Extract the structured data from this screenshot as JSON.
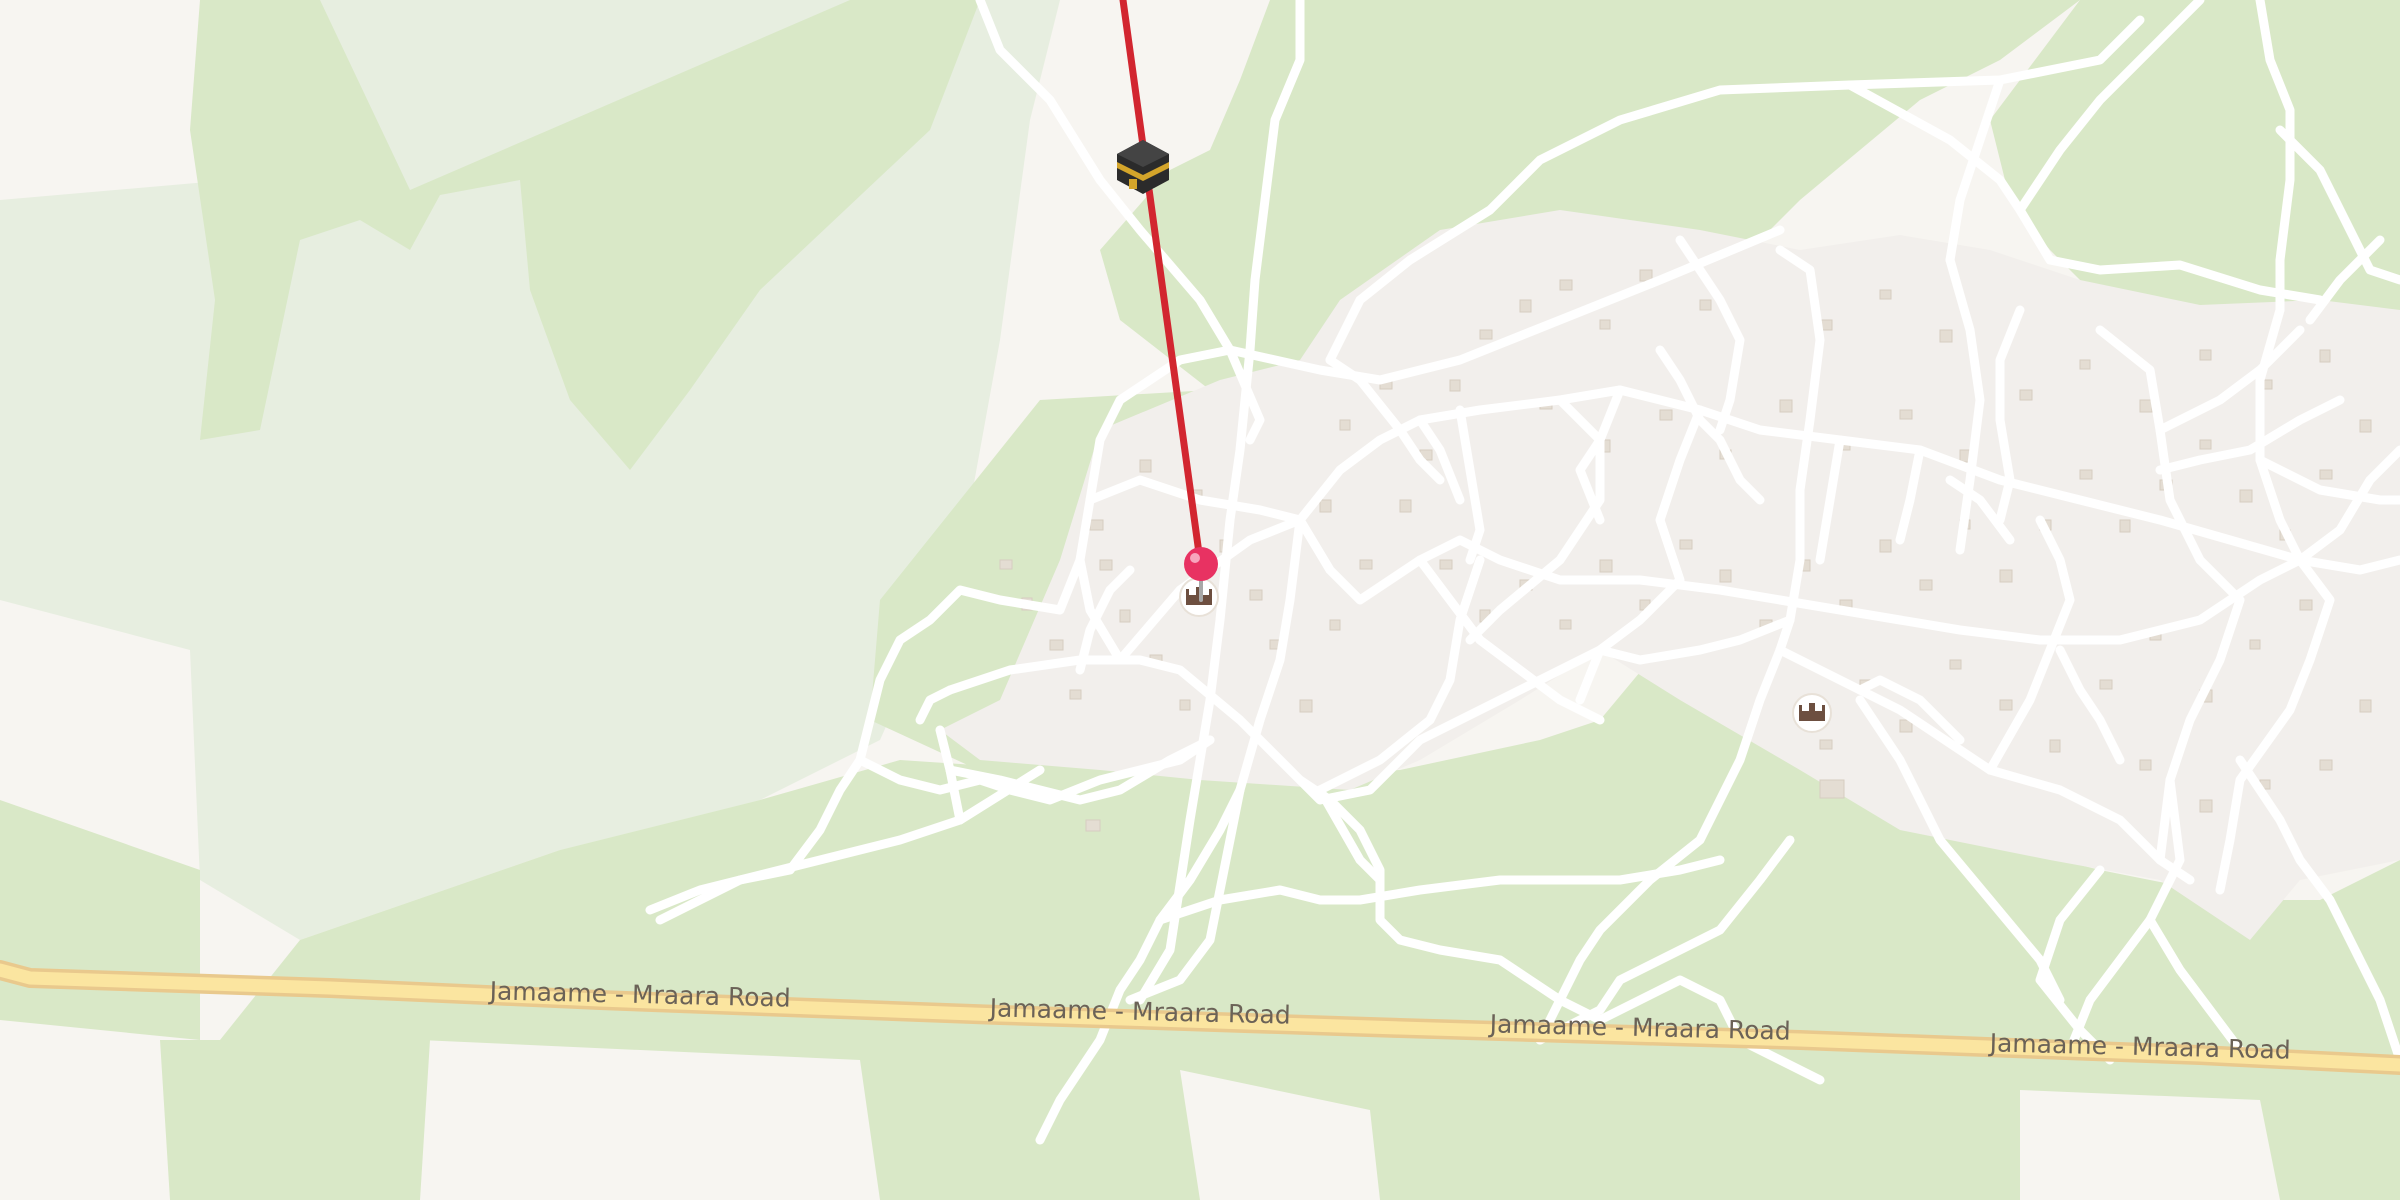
{
  "map": {
    "road_name": "Jamaame - Mraara Road",
    "colors": {
      "background": "#f7f5f1",
      "vegetation": "#d9e8c7",
      "scrub": "#e7eee0",
      "settlement": "#f2efec",
      "building": "#e4ddd3",
      "minor_road": "#ffffff",
      "main_road_fill": "#fbe5a0",
      "main_road_casing": "#e9c98d",
      "qibla_line": "#d22630",
      "location_pin": "#e83262",
      "poi_icon": "#6d4f40"
    },
    "icons": {
      "kaaba": "kaaba-icon",
      "pin": "location-pin-icon",
      "mosque_1": "mosque-icon",
      "mosque_2": "mosque-icon"
    }
  }
}
